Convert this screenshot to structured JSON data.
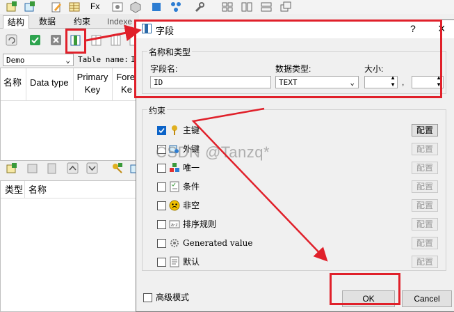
{
  "left_tabs": [
    "结构",
    "数据",
    "约束",
    "Indexe"
  ],
  "left_panel": {
    "db_select": "Demo",
    "table_name_label": "Table name:",
    "table_name_value": "I",
    "columns": [
      "名称",
      "Data type",
      "Primary Key",
      "Forei Ke"
    ],
    "lower_columns": [
      "类型",
      "名称"
    ]
  },
  "dialog": {
    "title": "字段",
    "help": "?",
    "close": "×",
    "group1_title": "名称和类型",
    "field_name_label": "字段名:",
    "field_name_value": "ID",
    "data_type_label": "数据类型:",
    "data_type_value": "TEXT",
    "size_label": "大小:",
    "size_sep": ",",
    "group2_title": "约束",
    "constraints": [
      {
        "label": "主键",
        "checked": true,
        "config": "配置",
        "enabled": true,
        "icon": "key-icon"
      },
      {
        "label": "外键",
        "checked": false,
        "config": "配置",
        "enabled": false,
        "icon": "foreign-key-icon"
      },
      {
        "label": "唯一",
        "checked": false,
        "config": "配置",
        "enabled": false,
        "icon": "unique-icon"
      },
      {
        "label": "条件",
        "checked": false,
        "config": "配置",
        "enabled": false,
        "icon": "check-list-icon"
      },
      {
        "label": "非空",
        "checked": false,
        "config": "配置",
        "enabled": false,
        "icon": "not-null-icon"
      },
      {
        "label": "排序规则",
        "checked": false,
        "config": "配置",
        "enabled": false,
        "icon": "collation-icon"
      },
      {
        "label": "Generated value",
        "checked": false,
        "config": "配置",
        "enabled": false,
        "icon": "gear-icon"
      },
      {
        "label": "默认",
        "checked": false,
        "config": "配置",
        "enabled": false,
        "icon": "default-icon"
      }
    ],
    "advanced_label": "高级模式",
    "ok": "OK",
    "cancel": "Cancel"
  },
  "watermark": "CSDN @Tanzq*",
  "colors": {
    "highlight": "#e0202a",
    "accent": "#0b63c8"
  }
}
